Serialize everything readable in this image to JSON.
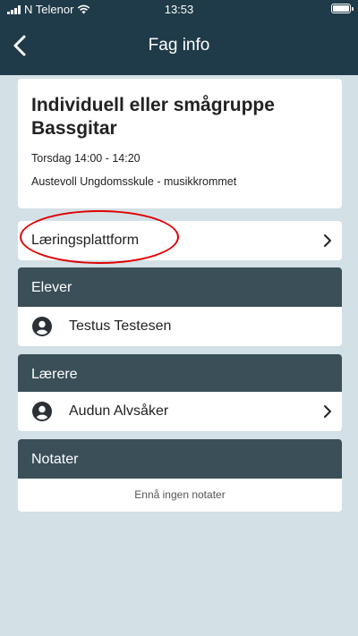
{
  "statusbar": {
    "carrier": "N Telenor",
    "time": "13:53"
  },
  "navbar": {
    "title": "Fag info",
    "back_icon": "chevron-left-icon"
  },
  "subject": {
    "name": "Individuell eller smågruppe Bassgitar",
    "time": "Torsdag 14:00 - 14:20",
    "location": "Austevoll Ungdomsskule - musikkrommet"
  },
  "learning_platform": {
    "label": "Læringsplattform"
  },
  "students": {
    "header": "Elever",
    "items": [
      {
        "name": "Testus Testesen"
      }
    ]
  },
  "teachers": {
    "header": "Lærere",
    "items": [
      {
        "name": "Audun Alvsåker"
      }
    ]
  },
  "notes": {
    "header": "Notater",
    "empty_text": "Ennå ingen notater"
  },
  "colors": {
    "navbar": "#1f3a48",
    "section_header": "#3b4f58",
    "background": "#d3e0e6",
    "annotation": "#e00000"
  }
}
